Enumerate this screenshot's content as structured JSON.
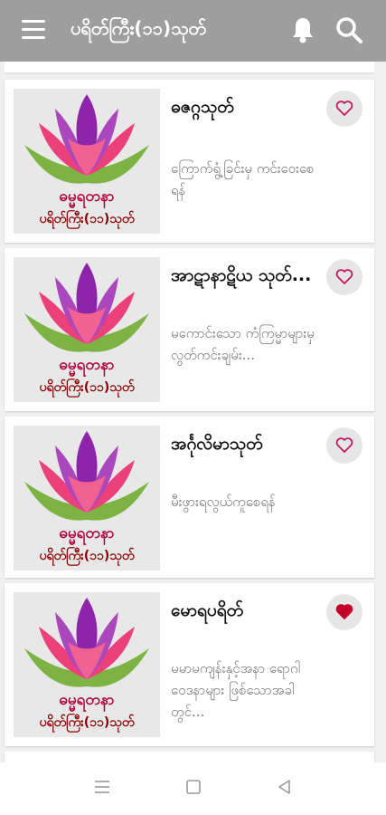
{
  "appbar": {
    "title": "ပရိတ်ကြီး(၁၁)သုတ်",
    "menu_icon": "menu-icon",
    "bell_icon": "bell-icon",
    "search_icon": "search-icon"
  },
  "thumbnail": {
    "line1": "ဓမ္မရတနာ",
    "line2": "ပရိတ်ကြီး(၁၁)သုတ်"
  },
  "items": [
    {
      "title": "ဓဇဂ္ဂသုတ်",
      "desc": "ကြောက်ရွံ့ခြင်းမှ ကင်းဝေးစေရန်",
      "favorite": false
    },
    {
      "title": "အာဋာနာဋိယ သုတ်...",
      "desc": "မကောင်းသော ကံကြမ္မာများမှ လွတ်ကင်းချမ်း...",
      "favorite": false
    },
    {
      "title": "အင်္ဂုလိမာသုတ်",
      "desc": "မီးဖွားရလွယ်ကူစေရန်",
      "favorite": false
    },
    {
      "title": "မောရပရိတ်",
      "desc": "မမာမကျန်းနှင့်အနာ ရောဂါဝေဒနာများ ဖြစ်သောအခါတွင်...",
      "favorite": true
    }
  ],
  "colors": {
    "appbar": "#9e9e9e",
    "heart": "#c2185b",
    "heart_filled": "#c2002a"
  },
  "navbar": {
    "recents_icon": "recents-icon",
    "home_icon": "home-icon",
    "back_icon": "back-icon"
  }
}
